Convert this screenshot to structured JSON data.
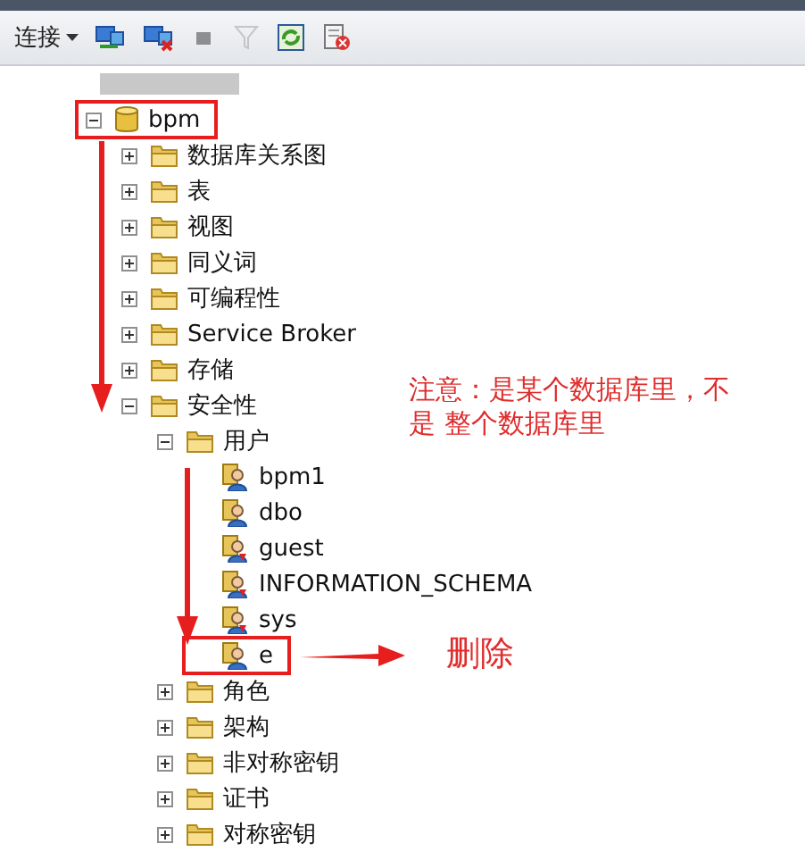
{
  "toolbar": {
    "connect_label": "连接",
    "buttons": [
      {
        "kind": "connect",
        "disabled": false
      },
      {
        "kind": "disconnect",
        "disabled": false
      },
      {
        "kind": "stop",
        "disabled": true
      },
      {
        "kind": "filter",
        "disabled": true
      },
      {
        "kind": "refresh",
        "disabled": false
      },
      {
        "kind": "report",
        "disabled": false
      }
    ]
  },
  "tree": [
    {
      "label": "bpm",
      "kind": "database",
      "expanded": true,
      "highlighted": true,
      "children": [
        {
          "label": "数据库关系图",
          "kind": "folder",
          "expanded": false,
          "highlighted": false
        },
        {
          "label": "表",
          "kind": "folder",
          "expanded": false,
          "highlighted": false
        },
        {
          "label": "视图",
          "kind": "folder",
          "expanded": false,
          "highlighted": false
        },
        {
          "label": "同义词",
          "kind": "folder",
          "expanded": false,
          "highlighted": false
        },
        {
          "label": "可编程性",
          "kind": "folder",
          "expanded": false,
          "highlighted": false
        },
        {
          "label": "Service Broker",
          "kind": "folder",
          "expanded": false,
          "highlighted": false
        },
        {
          "label": "存储",
          "kind": "folder",
          "expanded": false,
          "highlighted": false
        },
        {
          "label": "安全性",
          "kind": "folder",
          "expanded": true,
          "highlighted": false,
          "children": [
            {
              "label": "用户",
              "kind": "folder",
              "expanded": true,
              "highlighted": false,
              "children": [
                {
                  "label": "bpm1",
                  "kind": "user",
                  "restricted": false,
                  "highlighted": false
                },
                {
                  "label": "dbo",
                  "kind": "user",
                  "restricted": false,
                  "highlighted": false
                },
                {
                  "label": "guest",
                  "kind": "user",
                  "restricted": true,
                  "highlighted": false
                },
                {
                  "label": "INFORMATION_SCHEMA",
                  "kind": "user",
                  "restricted": true,
                  "highlighted": false
                },
                {
                  "label": "sys",
                  "kind": "user",
                  "restricted": true,
                  "highlighted": false
                },
                {
                  "label": "e",
                  "kind": "user",
                  "restricted": false,
                  "highlighted": true
                }
              ]
            },
            {
              "label": "角色",
              "kind": "folder",
              "expanded": false,
              "highlighted": false
            },
            {
              "label": "架构",
              "kind": "folder",
              "expanded": false,
              "highlighted": false
            },
            {
              "label": "非对称密钥",
              "kind": "folder",
              "expanded": false,
              "highlighted": false
            },
            {
              "label": "证书",
              "kind": "folder",
              "expanded": false,
              "highlighted": false
            },
            {
              "label": "对称密钥",
              "kind": "folder",
              "expanded": false,
              "highlighted": false
            }
          ]
        }
      ]
    }
  ],
  "annotations": {
    "note": "注意：是某个数据库里，不是 整个数据库里",
    "action": "删除"
  }
}
